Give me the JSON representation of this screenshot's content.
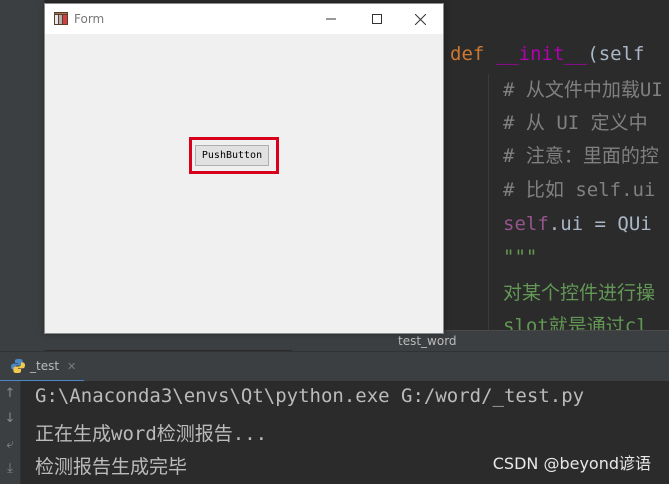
{
  "form": {
    "title": "Form",
    "push_button_label": "PushButton"
  },
  "editor": {
    "lines": [
      {
        "kw": "def",
        "name": "__init__",
        "rest": "(self"
      },
      {
        "text": "# 从文件中加载UI"
      },
      {
        "text": "# 从 UI 定义中"
      },
      {
        "text": "# 注意：里面的控"
      },
      {
        "text": "# 比如 self.ui"
      },
      {
        "self": "self",
        "rest": ".ui = QUi"
      },
      {
        "text": "\"\"\""
      },
      {
        "text": "对某个控件进行操"
      },
      {
        "text": "slot就是通过cl"
      }
    ],
    "filename": "test_word"
  },
  "run_panel": {
    "tab_label": "_test",
    "console": [
      "G:\\Anaconda3\\envs\\Qt\\python.exe G:/word/_test.py",
      "正在生成word检测报告...",
      "检测报告生成完毕"
    ]
  },
  "watermark": "CSDN @beyond谚语",
  "icons": [
    "app-icon",
    "minimize-icon",
    "maximize-icon",
    "close-icon",
    "python-icon",
    "arrow-up-icon",
    "arrow-down-icon",
    "wrap-icon",
    "scroll-end-icon"
  ],
  "colors": {
    "ide_bg": "#2b2b2b",
    "panel_bg": "#3c3f41",
    "keyword": "#cc7832",
    "magic": "#b200b2",
    "comment": "#808080",
    "docstring": "#629755",
    "highlight": "#d9001b",
    "window_bg": "#f0f0f0"
  }
}
